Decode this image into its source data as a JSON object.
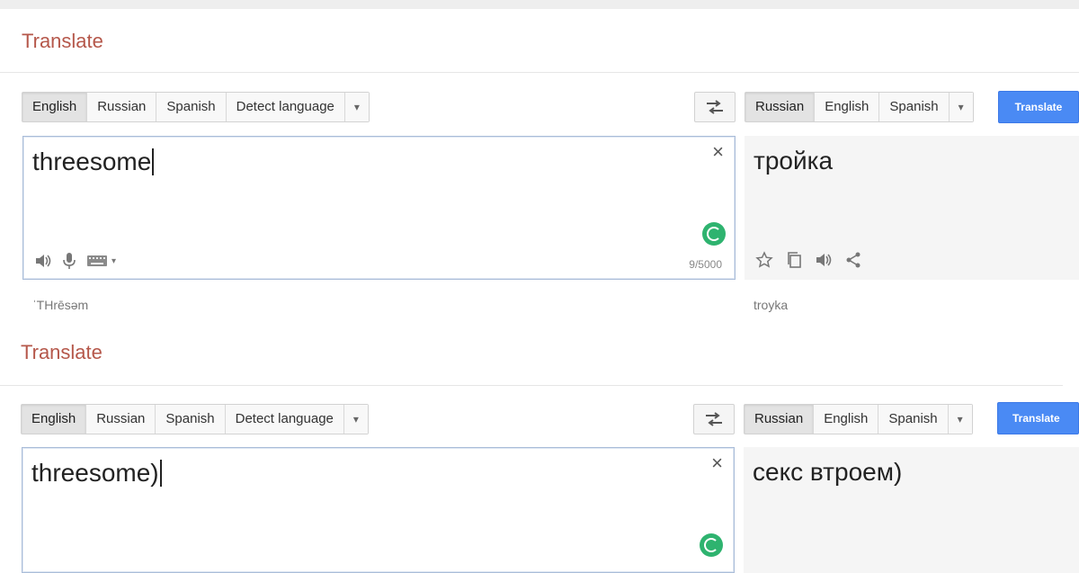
{
  "panels": [
    {
      "title": "Translate",
      "source_languages": [
        "English",
        "Russian",
        "Spanish",
        "Detect language"
      ],
      "source_active": "English",
      "target_languages": [
        "Russian",
        "English",
        "Spanish"
      ],
      "target_active": "Russian",
      "translate_label": "Translate",
      "source_text": "threesome",
      "target_text": "тройка",
      "char_count": "9/5000",
      "source_translit": "ˈTHrēsəm",
      "target_translit": "troyka"
    },
    {
      "title": "Translate",
      "source_languages": [
        "English",
        "Russian",
        "Spanish",
        "Detect language"
      ],
      "source_active": "English",
      "target_languages": [
        "Russian",
        "English",
        "Spanish"
      ],
      "target_active": "Russian",
      "translate_label": "Translate",
      "source_text": "threesome)",
      "target_text": "секс втроем)"
    }
  ],
  "icons": {
    "swap": "swap-arrows-icon",
    "dropdown": "chevron-down-icon",
    "clear": "close-icon",
    "status": "spinner-icon",
    "speaker": "speaker-icon",
    "mic": "microphone-icon",
    "keyboard": "keyboard-icon",
    "star": "star-icon",
    "copy": "copy-icon",
    "share": "share-icon"
  },
  "colors": {
    "title": "#b5574a",
    "translate_button": "#4a8af4",
    "spinner": "#2eb36f"
  }
}
